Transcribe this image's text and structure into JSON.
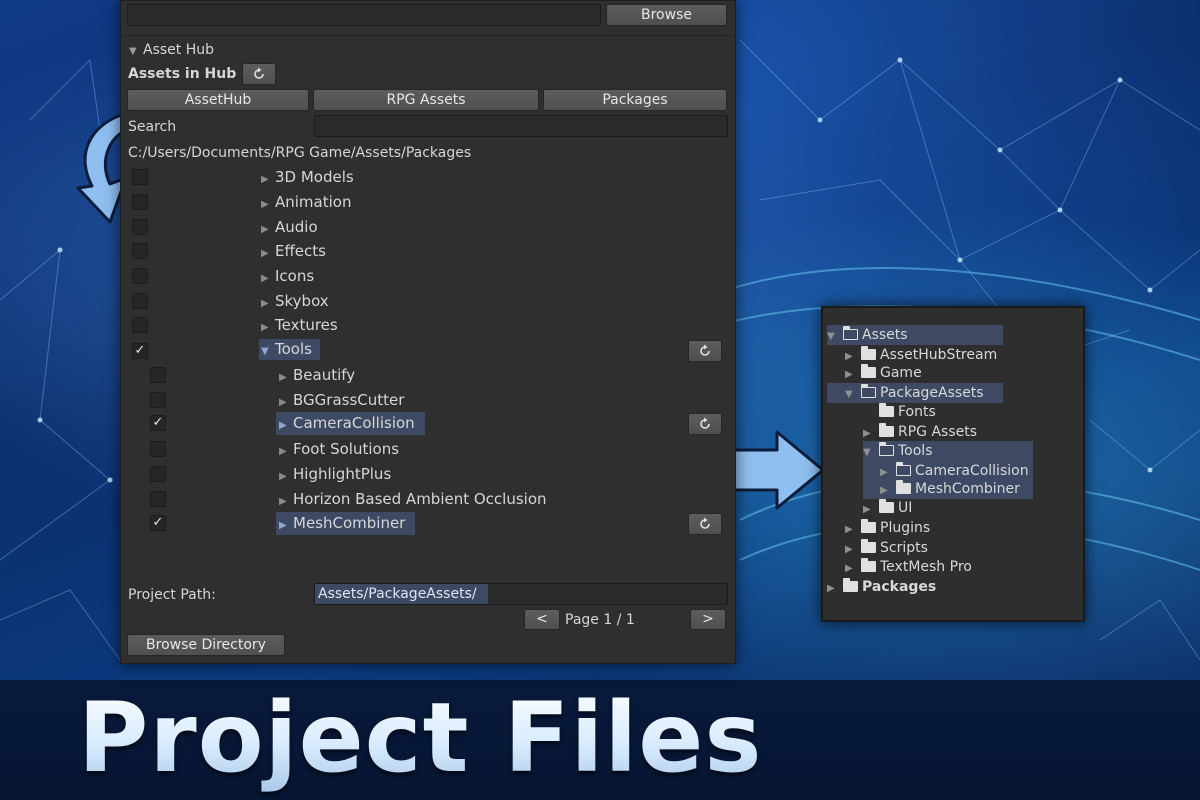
{
  "colors": {
    "accent_selection": "#3e4a63",
    "panel": "#2f2f2f",
    "arrow": "#8fbef0"
  },
  "top": {
    "browse_label": "Browse"
  },
  "hub": {
    "section_title": "Asset Hub",
    "assets_label": "Assets in Hub",
    "refresh_icon": "refresh-icon",
    "tabs": [
      "AssetHub",
      "RPG Assets",
      "Packages"
    ],
    "search_label": "Search",
    "search_value": "",
    "path": "C:/Users/Documents/RPG Game/Assets/Packages"
  },
  "folders": [
    {
      "label": "3D Models",
      "checked": false
    },
    {
      "label": "Animation",
      "checked": false
    },
    {
      "label": "Audio",
      "checked": false
    },
    {
      "label": "Effects",
      "checked": false
    },
    {
      "label": "Icons",
      "checked": false
    },
    {
      "label": "Skybox",
      "checked": false
    },
    {
      "label": "Textures",
      "checked": false
    },
    {
      "label": "Tools",
      "checked": true,
      "expanded": true
    }
  ],
  "tools_children": [
    {
      "label": "Beautify",
      "checked": false
    },
    {
      "label": "BGGrassCutter",
      "checked": false
    },
    {
      "label": "CameraCollision",
      "checked": true
    },
    {
      "label": "Foot Solutions",
      "checked": false
    },
    {
      "label": "HighlightPlus",
      "checked": false
    },
    {
      "label": "Horizon Based Ambient Occlusion",
      "checked": false
    },
    {
      "label": "MeshCombiner",
      "checked": true
    }
  ],
  "footer": {
    "project_path_label": "Project Path:",
    "project_path_value": "Assets/PackageAssets/",
    "prev_label": "<",
    "page_label": "Page 1 / 1",
    "next_label": ">",
    "browse_directory_label": "Browse Directory"
  },
  "project_tree": [
    {
      "label": "Assets",
      "depth": 0,
      "expanded": true,
      "bold": false
    },
    {
      "label": "AssetHubStream",
      "depth": 1
    },
    {
      "label": "Game",
      "depth": 1
    },
    {
      "label": "PackageAssets",
      "depth": 1,
      "expanded": true
    },
    {
      "label": "Fonts",
      "depth": 2,
      "leaf": true
    },
    {
      "label": "RPG Assets",
      "depth": 2
    },
    {
      "label": "Tools",
      "depth": 2,
      "expanded": true
    },
    {
      "label": "CameraCollision",
      "depth": 3
    },
    {
      "label": "MeshCombiner",
      "depth": 3
    },
    {
      "label": "UI",
      "depth": 2
    },
    {
      "label": "Plugins",
      "depth": 1
    },
    {
      "label": "Scripts",
      "depth": 1
    },
    {
      "label": "TextMesh Pro",
      "depth": 1
    },
    {
      "label": "Packages",
      "depth": 0,
      "bold": true
    }
  ],
  "banner": {
    "title": "Project Files"
  }
}
